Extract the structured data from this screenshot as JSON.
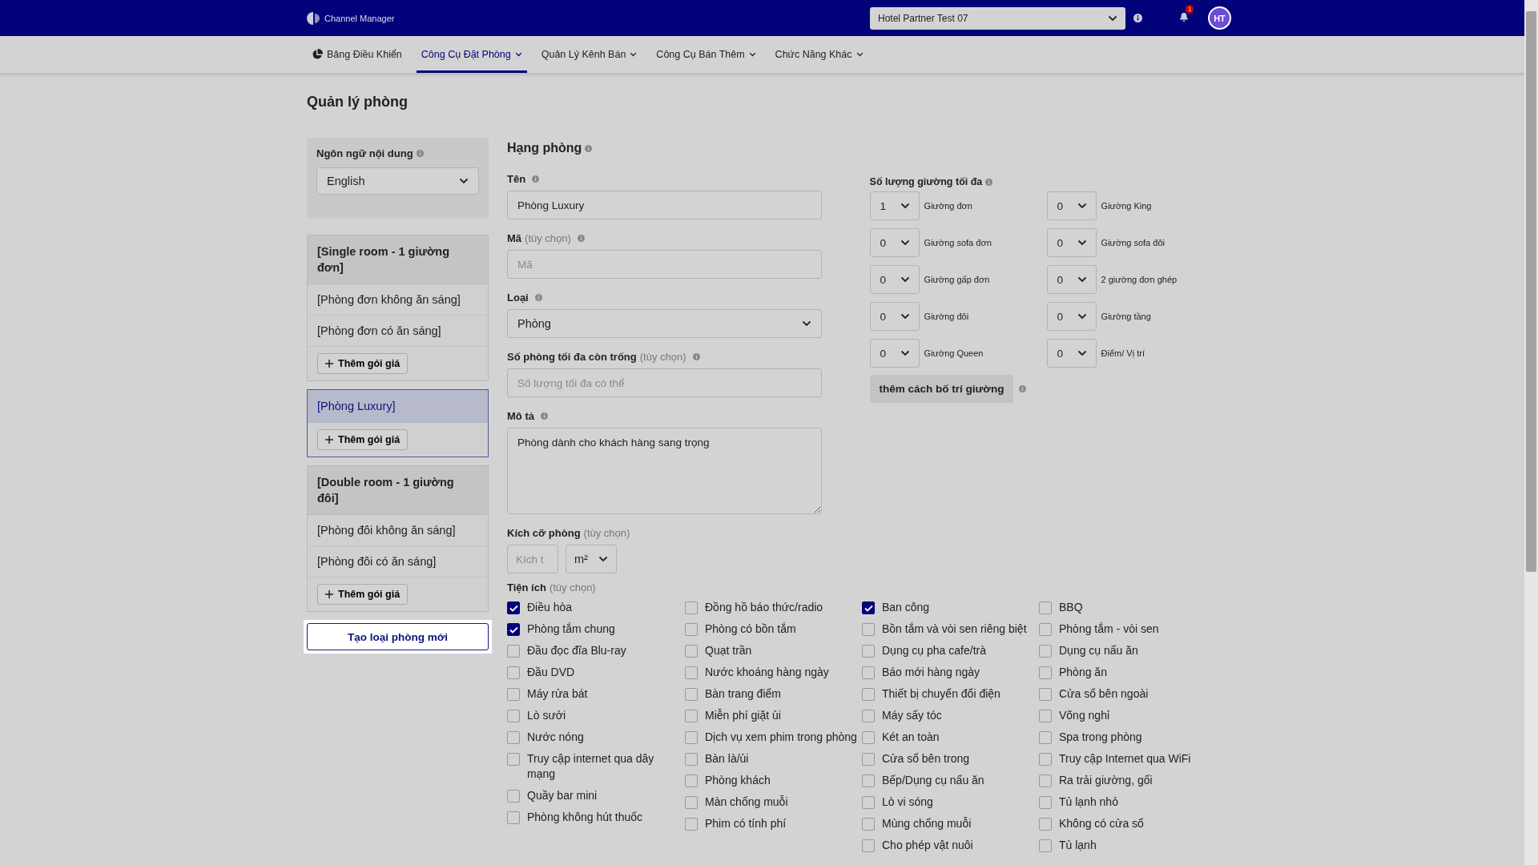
{
  "header": {
    "logo_text": "Channel Manager",
    "hotel_select": "Hotel Partner Test 07",
    "notification_count": "1",
    "avatar": "HT"
  },
  "nav": [
    {
      "label": "Bảng Điều Khiển",
      "kind": "icon",
      "selected": false
    },
    {
      "label": "Công Cụ Đặt Phòng",
      "kind": "dropdown",
      "selected": true
    },
    {
      "label": "Quản Lý Kênh Bán",
      "kind": "dropdown",
      "selected": false
    },
    {
      "label": "Công Cụ Bán Thêm",
      "kind": "dropdown",
      "selected": false
    },
    {
      "label": "Chức Năng Khác",
      "kind": "dropdown",
      "selected": false
    }
  ],
  "page_title": "Quản lý phòng",
  "language": {
    "label": "Ngôn ngữ nội dung",
    "value": "English"
  },
  "room_types": [
    {
      "name": "[Single room - 1 giường đơn]",
      "selected": false,
      "rate_plans": [
        "[Phòng đơn không ăn sáng]",
        "[Phòng đơn có ăn sáng]"
      ],
      "add_button": "Thêm gói giá"
    },
    {
      "name": "[Phòng Luxury]",
      "selected": true,
      "add_button": "Thêm gói giá"
    },
    {
      "name": "[Double room - 1 giường đôi]",
      "selected": false,
      "rate_plans": [
        "[Phòng đôi không ăn sáng]",
        "[Phòng đôi có ăn sáng]"
      ],
      "add_button": "Thêm gói giá"
    }
  ],
  "create_button": "Tạo loại phòng mới",
  "form": {
    "title": "Hạng phòng",
    "fields": [
      {
        "kind": "text",
        "label": "Tên",
        "value": "Phòng Luxury"
      },
      {
        "kind": "text",
        "label": "Mã",
        "optional": "(tùy chọn)",
        "placeholder": "Mã"
      },
      {
        "kind": "select",
        "label": "Loại",
        "value": "Phòng"
      },
      {
        "kind": "text",
        "label": "Số phòng tối đa còn trống",
        "optional": "(tùy chọn)",
        "placeholder": "Số lượng tối đa có thể"
      },
      {
        "kind": "textarea",
        "label": "Mô tả",
        "value": "Phòng dành cho khách hàng sang trọng"
      }
    ],
    "size": {
      "label": "Kích cỡ phòng",
      "optional": "(tùy chọn)",
      "placeholder": "Kích t",
      "unit": "m²"
    }
  },
  "beds": {
    "label": "Số lượng giường tối đa",
    "items": [
      {
        "count": "1",
        "label": "Giường đơn"
      },
      {
        "count": "0",
        "label": "Giường King"
      },
      {
        "count": "0",
        "label": "Giường sofa đơn"
      },
      {
        "count": "0",
        "label": "Giường sofa đôi"
      },
      {
        "count": "0",
        "label": "Giường gấp đơn"
      },
      {
        "count": "0",
        "label": "2 giường đơn ghép"
      },
      {
        "count": "0",
        "label": "Giường đôi"
      },
      {
        "count": "0",
        "label": "Giường tầng"
      },
      {
        "count": "0",
        "label": "Giường Queen"
      },
      {
        "count": "0",
        "label": "Điểm/ Vị trí"
      }
    ],
    "add_button": "thêm cách bố trí giường"
  },
  "amenities": {
    "label": "Tiện ích",
    "optional": "(tùy chọn)",
    "columns": [
      [
        {
          "label": "Điều hòa",
          "checked": true
        },
        {
          "label": "Phòng tắm chung",
          "checked": true
        },
        {
          "label": "Đầu đọc đĩa Blu-ray",
          "checked": false
        },
        {
          "label": "Đầu DVD",
          "checked": false
        },
        {
          "label": "Máy rửa bát",
          "checked": false
        },
        {
          "label": "Lò sưởi",
          "checked": false
        },
        {
          "label": "Nước nóng",
          "checked": false
        },
        {
          "label": "Truy cập internet qua dây mạng",
          "checked": false
        },
        {
          "label": "Quầy bar mini",
          "checked": false
        },
        {
          "label": "Phòng không hút thuốc",
          "checked": false
        }
      ],
      [
        {
          "label": "Đồng hồ báo thức/radio",
          "checked": false
        },
        {
          "label": "Phòng có bồn tắm",
          "checked": false
        },
        {
          "label": "Quạt trần",
          "checked": false
        },
        {
          "label": "Nước khoáng hàng ngày",
          "checked": false
        },
        {
          "label": "Bàn trang điểm",
          "checked": false
        },
        {
          "label": "Miễn phí giặt ủi",
          "checked": false
        },
        {
          "label": "Dịch vụ xem phim trong phòng",
          "checked": false
        },
        {
          "label": "Bàn là/ủi",
          "checked": false
        },
        {
          "label": "Phòng khách",
          "checked": false
        },
        {
          "label": "Màn chống muỗi",
          "checked": false
        },
        {
          "label": "Phim có tính phí",
          "checked": false
        }
      ],
      [
        {
          "label": "Ban công",
          "checked": true
        },
        {
          "label": "Bồn tắm và vòi sen riêng biệt",
          "checked": false
        },
        {
          "label": "Dụng cụ pha cafe/trà",
          "checked": false
        },
        {
          "label": "Báo mới hàng ngày",
          "checked": false
        },
        {
          "label": "Thiết bị chuyển đổi điện",
          "checked": false
        },
        {
          "label": "Máy sấy tóc",
          "checked": false
        },
        {
          "label": "Két an toàn",
          "checked": false
        },
        {
          "label": "Cửa sổ bên trong",
          "checked": false
        },
        {
          "label": "Bếp/Dụng cụ nấu ăn",
          "checked": false
        },
        {
          "label": "Lò vi sóng",
          "checked": false
        },
        {
          "label": "Mùng chống muỗi",
          "checked": false
        },
        {
          "label": "Cho phép vật nuôi",
          "checked": false
        }
      ],
      [
        {
          "label": "BBQ",
          "checked": false
        },
        {
          "label": "Phòng tắm - vòi sen",
          "checked": false
        },
        {
          "label": "Dụng cụ nấu ăn",
          "checked": false
        },
        {
          "label": "Phòng ăn",
          "checked": false
        },
        {
          "label": "Cửa sổ bên ngoài",
          "checked": false
        },
        {
          "label": "Võng nghỉ",
          "checked": false
        },
        {
          "label": "Spa trong phòng",
          "checked": false
        },
        {
          "label": "Truy cập Internet qua WiFi",
          "checked": false
        },
        {
          "label": "Ra trải giường, gối",
          "checked": false
        },
        {
          "label": "Tủ lạnh nhỏ",
          "checked": false
        },
        {
          "label": "Không có cửa sổ",
          "checked": false
        },
        {
          "label": "Tủ lạnh",
          "checked": false
        }
      ]
    ]
  }
}
